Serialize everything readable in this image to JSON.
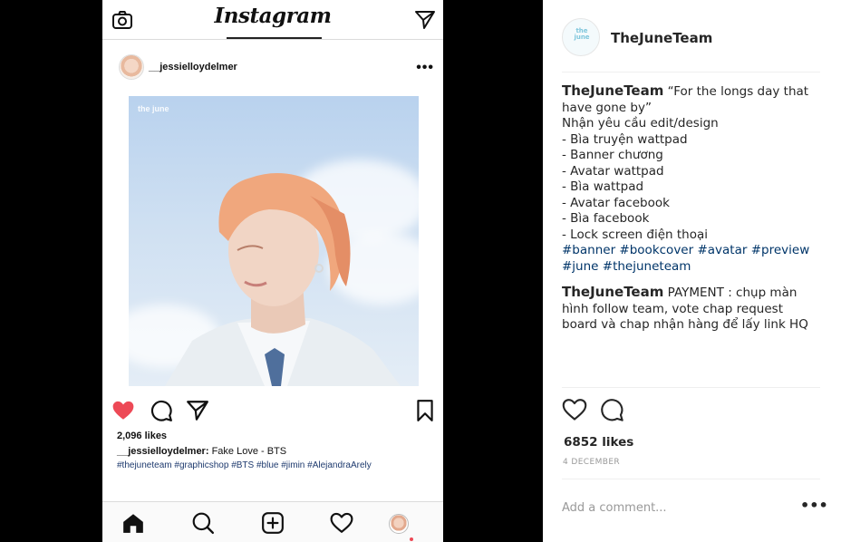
{
  "phone": {
    "logo": "Instagram",
    "post_username": "__jessielloydelmer",
    "more_dots": "•••",
    "image_watermark": "the june",
    "likes": "2,096 likes",
    "caption_user": "__jessielloydelmer:",
    "caption_text": " Fake Love - BTS",
    "tags": "#thejuneteam #graphicshop #BTS #blue #jimin #AlejandraArely"
  },
  "panel": {
    "username": "TheJuneTeam",
    "avatar_mark": "the june",
    "caption_user": "TheJuneTeam",
    "caption_lines": [
      "“For the longs day that",
      "have gone by”",
      "Nhận yêu cầu edit/design",
      "- Bìa truyện wattpad",
      "- Banner chương",
      "- Avatar wattpad",
      "- Bìa wattpad",
      "- Avatar facebook",
      "- Bìa facebook",
      "- Lock screen điện thoại",
      "#banner #bookcover #avatar #preview",
      "#june #thejuneteam"
    ],
    "comment_user": "TheJuneTeam",
    "comment_text": "PAYMENT : chụp màn hình follow team, vote chap request board và chap nhận hàng để lấy link HQ",
    "likes": "6852 likes",
    "date": "4 DECEMBER",
    "add_comment_placeholder": "Add a comment...",
    "more_dots": "•••"
  },
  "colors": {
    "heart_red": "#ed4956",
    "link_blue": "#003569",
    "divider": "#dbdbdb"
  },
  "icons": [
    "camera-icon",
    "direct-send-icon",
    "heart-filled-icon",
    "comment-icon",
    "share-icon",
    "bookmark-icon",
    "home-icon",
    "search-icon",
    "add-icon",
    "activity-heart-icon",
    "heart-outline-icon"
  ]
}
